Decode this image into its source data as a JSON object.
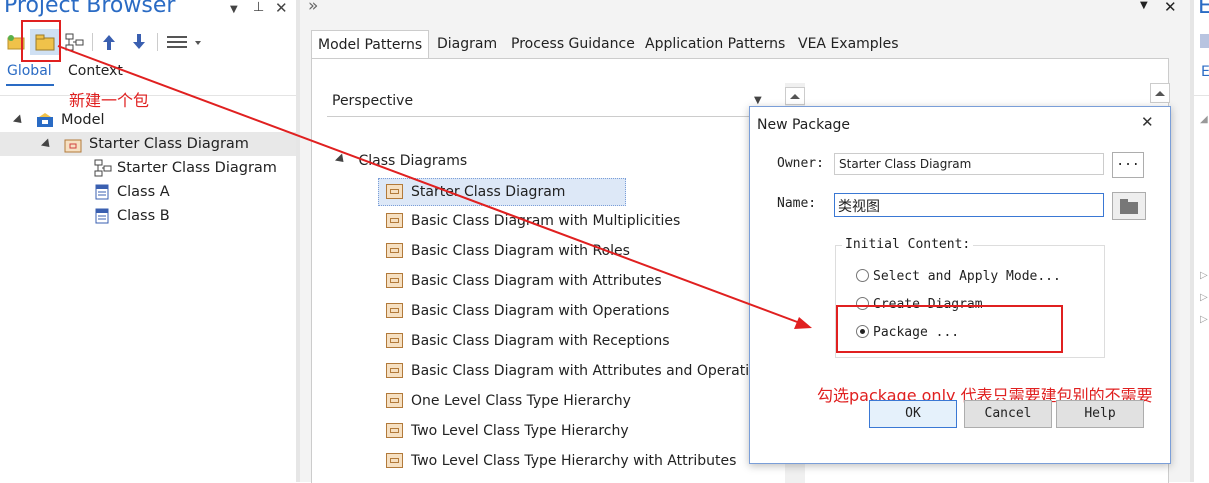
{
  "project_browser": {
    "title": "Project Browser",
    "tabs": [
      "Global",
      "Context"
    ],
    "annotation": "新建一个包",
    "tree": [
      {
        "label": "Model"
      },
      {
        "label": "Starter Class Diagram"
      },
      {
        "label": "Starter Class Diagram"
      },
      {
        "label": "Class A"
      },
      {
        "label": "Class B"
      }
    ]
  },
  "patterns": {
    "tabs": [
      "Model Patterns",
      "Diagram",
      "Process Guidance",
      "Application Patterns",
      "VEA Examples"
    ],
    "perspective_label": "Perspective",
    "group_label": "Class Diagrams",
    "items": [
      "Starter Class Diagram",
      "Basic Class Diagram with Multiplicities",
      "Basic Class Diagram with Roles",
      "Basic Class Diagram with Attributes",
      "Basic Class Diagram with Operations",
      "Basic Class Diagram with Receptions",
      "Basic Class Diagram with Attributes and Operations",
      "One Level Class Type Hierarchy",
      "Two Level Class Type Hierarchy",
      "Two Level Class Type Hierarchy with Attributes"
    ]
  },
  "dialog": {
    "title": "New Package",
    "owner_label": "Owner:",
    "owner_value": "Starter Class Diagram",
    "browse_label": "...",
    "name_label": "Name:",
    "name_value": "类视图",
    "initial_content_label": "Initial Content:",
    "options": [
      "Select and Apply Mode...",
      "Create Diagram",
      "Package ..."
    ],
    "selected_option": "Package ...",
    "ok_label": "OK",
    "cancel_label": "Cancel",
    "help_label": "Help",
    "annotation": "勾选package only 代表只需要建包别的不需要"
  },
  "right_pane": {
    "letters": [
      "E",
      "E"
    ]
  },
  "colors": {
    "accent": "#2a6bc4",
    "annotation": "#e02020",
    "selection": "#dde8f7"
  }
}
